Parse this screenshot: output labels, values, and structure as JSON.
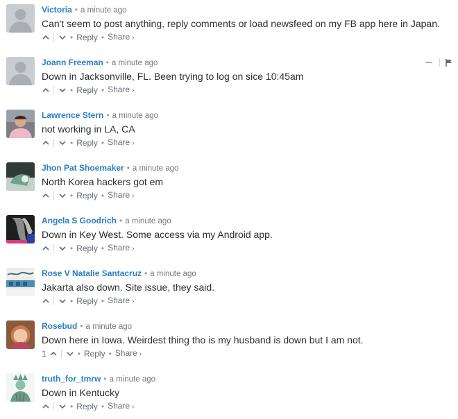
{
  "comments": [
    {
      "author": "Victoria",
      "time": "a minute ago",
      "text": "Can't seem to post anything, reply comments or load newsfeed on my FB app here in Japan.",
      "reply_label": "Reply",
      "share_label": "Share",
      "avatar": "default-avatar"
    },
    {
      "author": "Joann Freeman",
      "time": "a minute ago",
      "text": "Down in Jacksonville, FL. Been trying to log on sice 10:45am",
      "reply_label": "Reply",
      "share_label": "Share",
      "avatar": "default-avatar"
    },
    {
      "author": "Lawrence Stern",
      "time": "a minute ago",
      "text": "not working in LA, CA",
      "reply_label": "Reply",
      "share_label": "Share",
      "avatar": "photo-avatar"
    },
    {
      "author": "Jhon Pat Shoemaker",
      "time": "a minute ago",
      "text": "North Korea hackers got em",
      "reply_label": "Reply",
      "share_label": "Share",
      "avatar": "photo-avatar"
    },
    {
      "author": "Angela S Goodrich",
      "time": "a minute ago",
      "text": "Down in Key West. Some access via my Android app.",
      "reply_label": "Reply",
      "share_label": "Share",
      "avatar": "photo-avatar"
    },
    {
      "author": "Rose V Natalie Santacruz",
      "time": "a minute ago",
      "text": "Jakarta also down. Site issue, they said.",
      "reply_label": "Reply",
      "share_label": "Share",
      "avatar": "photo-avatar"
    },
    {
      "author": "Rosebud",
      "time": "a minute ago",
      "text": "Down here in Iowa. Weirdest thing tho is my husband is down but I am not.",
      "upvotes": "1",
      "reply_label": "Reply",
      "share_label": "Share",
      "avatar": "photo-avatar"
    },
    {
      "author": "truth_for_tmrw",
      "time": "a minute ago",
      "text": "Down in Kentucky",
      "reply_label": "Reply",
      "share_label": "Share",
      "avatar": "photo-avatar"
    }
  ],
  "icons": {
    "separator": "•",
    "share_chevron": "›"
  },
  "colors": {
    "author_link": "#2a7fc1",
    "body_text": "#2a2e2e",
    "meta_text": "#656c7a"
  }
}
